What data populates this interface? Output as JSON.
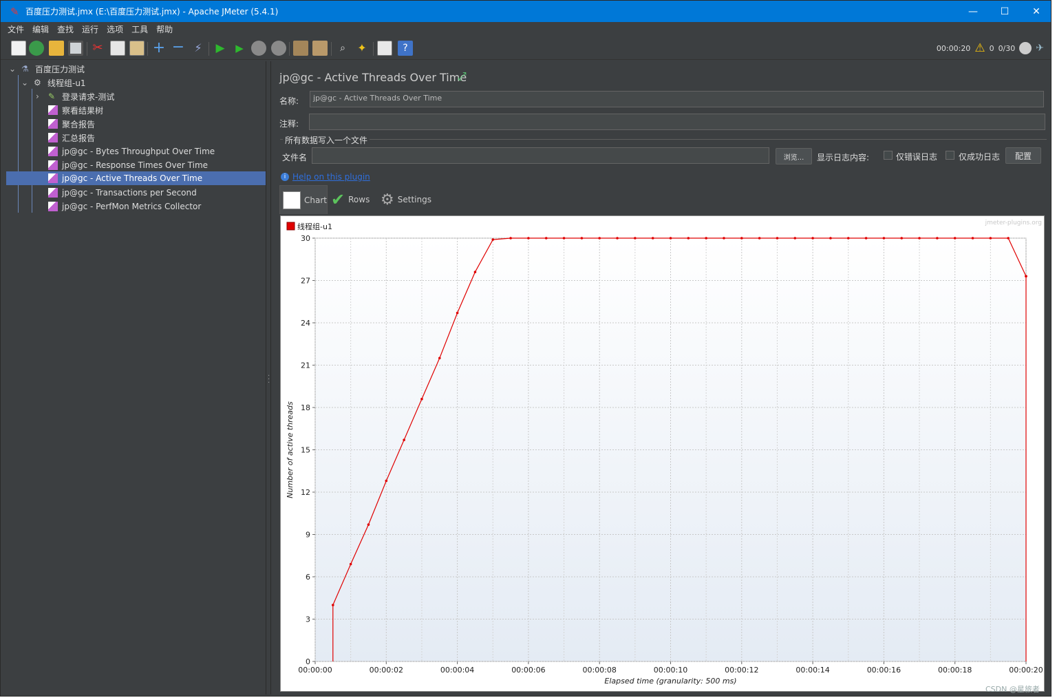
{
  "window": {
    "title": "百度压力测试.jmx (E:\\百度压力测试.jmx) - Apache JMeter (5.4.1)",
    "minimize": "—",
    "maximize": "☐",
    "close": "✕"
  },
  "menu": [
    "文件",
    "编辑",
    "查找",
    "运行",
    "选项",
    "工具",
    "帮助"
  ],
  "toolbar_status": {
    "elapsed": "00:00:20",
    "warnings": "0",
    "threads": "0/30"
  },
  "tree": {
    "test_plan": "百度压力测试",
    "thread_group": "线程组-u1",
    "sampler": "登录请求-测试",
    "listeners": [
      "察看结果树",
      "聚合报告",
      "汇总报告",
      "jp@gc - Bytes Throughput Over Time",
      "jp@gc - Response Times Over Time",
      "jp@gc - Active Threads Over Time",
      "jp@gc - Transactions per Second",
      "jp@gc - PerfMon Metrics Collector"
    ]
  },
  "panel": {
    "title": "jp@gc - Active Threads Over Time",
    "name_label": "名称:",
    "name_value": "jp@gc - Active Threads Over Time",
    "comment_label": "注释:",
    "comment_value": "",
    "file_section": "所有数据写入一个文件",
    "filename_label": "文件名",
    "filename_value": "",
    "browse": "浏览...",
    "log_label": "显示日志内容:",
    "errors_only": "仅错误日志",
    "success_only": "仅成功日志",
    "configure": "配置",
    "help_link": "Help on this plugin",
    "tabs": [
      "Chart",
      "Rows",
      "Settings"
    ]
  },
  "colors": {
    "series": "#e00000",
    "selection": "#4b6eaf",
    "titlebar": "#0078d7"
  },
  "chart_data": {
    "type": "line",
    "watermark": "jmeter-plugins.org",
    "series": [
      {
        "name": "线程组-u1",
        "x_seconds": [
          0.5,
          0.5,
          1,
          1.5,
          2,
          2.5,
          3,
          3.5,
          4,
          4.5,
          5,
          5.5,
          6,
          6.5,
          7,
          7.5,
          8,
          8.5,
          9,
          9.5,
          10,
          10.5,
          11,
          11.5,
          12,
          12.5,
          13,
          13.5,
          14,
          14.5,
          15,
          15.5,
          16,
          16.5,
          17,
          17.5,
          18,
          18.5,
          19,
          19.5,
          20,
          20,
          20
        ],
        "values": [
          0,
          4,
          6.9,
          9.7,
          12.8,
          15.7,
          18.6,
          21.5,
          24.7,
          27.6,
          29.9,
          30,
          30,
          30,
          30,
          30,
          30,
          30,
          30,
          30,
          30,
          30,
          30,
          30,
          30,
          30,
          30,
          30,
          30,
          30,
          30,
          30,
          30,
          30,
          30,
          30,
          30,
          30,
          30,
          30,
          27.3,
          27.3,
          0
        ]
      }
    ],
    "xlim": [
      0,
      20
    ],
    "ylim": [
      0,
      30
    ],
    "x_ticks": [
      "00:00:00",
      "00:00:02",
      "00:00:04",
      "00:00:06",
      "00:00:08",
      "00:00:10",
      "00:00:12",
      "00:00:14",
      "00:00:16",
      "00:00:18",
      "00:00:20"
    ],
    "y_ticks": [
      "0",
      "3",
      "6",
      "9",
      "12",
      "15",
      "18",
      "21",
      "24",
      "27",
      "30"
    ],
    "xlabel": "Elapsed time (granularity: 500 ms)",
    "ylabel": "Number of active threads",
    "grid": true,
    "legend": "top-left"
  },
  "footer_watermark": "CSDN @星旅者"
}
